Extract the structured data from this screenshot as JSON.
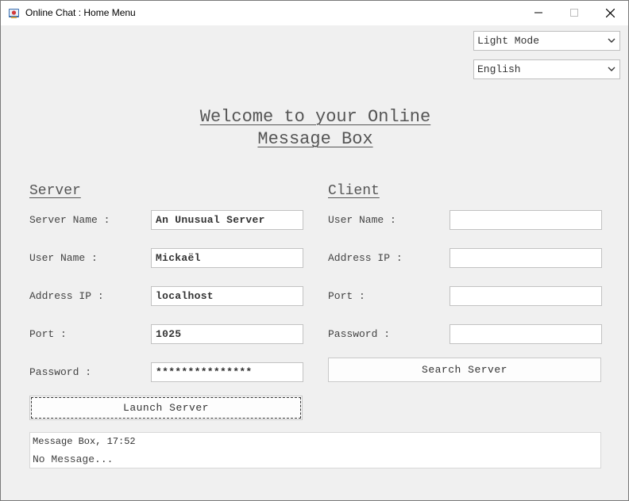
{
  "window": {
    "title": "Online Chat : Home Menu",
    "minimize_glyph": "—",
    "maximize_glyph": "☐",
    "close_glyph": "✕"
  },
  "settings": {
    "theme": "Light Mode",
    "language": "English"
  },
  "headline": {
    "line1": "Welcome to your Online",
    "line2": "Message Box"
  },
  "server": {
    "title": "Server",
    "labels": {
      "server_name": "Server Name :",
      "user_name": "User Name :",
      "address_ip": "Address IP :",
      "port": "Port :",
      "password": "Password :"
    },
    "values": {
      "server_name": "An Unusual Server",
      "user_name": "Mickaël",
      "address_ip": "localhost",
      "port": "1025",
      "password": "***************"
    },
    "launch_label": "Launch Server"
  },
  "client": {
    "title": "Client",
    "labels": {
      "user_name": "User Name :",
      "address_ip": "Address IP :",
      "port": "Port :",
      "password": "Password :"
    },
    "values": {
      "user_name": "",
      "address_ip": "",
      "port": "",
      "password": ""
    },
    "search_label": "Search Server"
  },
  "message_box": {
    "header": "Message Box, 17:52",
    "body": "No Message..."
  },
  "colors": {
    "window_bg": "#f0f0f0",
    "titlebar_bg": "#ffffff",
    "text": "#444444"
  }
}
